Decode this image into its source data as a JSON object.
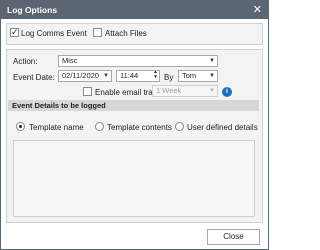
{
  "window": {
    "title": "Log Options",
    "close_glyph": "✕"
  },
  "options": {
    "log_comms_event": {
      "label": "Log Comms Event",
      "checked": true,
      "mark": "✓"
    },
    "attach_files": {
      "label": "Attach Files",
      "checked": false
    }
  },
  "form": {
    "action": {
      "label": "Action:",
      "value": "Misc"
    },
    "event_date": {
      "label": "Event Date:",
      "date": "02/11/2020",
      "time": "11:44",
      "by_label": "By",
      "by_value": "Tom"
    },
    "email_tracking": {
      "label": "Enable email tracking for",
      "checked": false,
      "value": "1 Week"
    }
  },
  "details": {
    "heading": "Event Details to be logged",
    "radios": [
      {
        "label": "Template name",
        "selected": true
      },
      {
        "label": "Template contents",
        "selected": false
      },
      {
        "label": "User defined details",
        "selected": false
      }
    ]
  },
  "icons": {
    "dropdown": "▼",
    "spin_up": "▲",
    "spin_down": "▼",
    "info": "i"
  },
  "buttons": {
    "close": "Close"
  }
}
